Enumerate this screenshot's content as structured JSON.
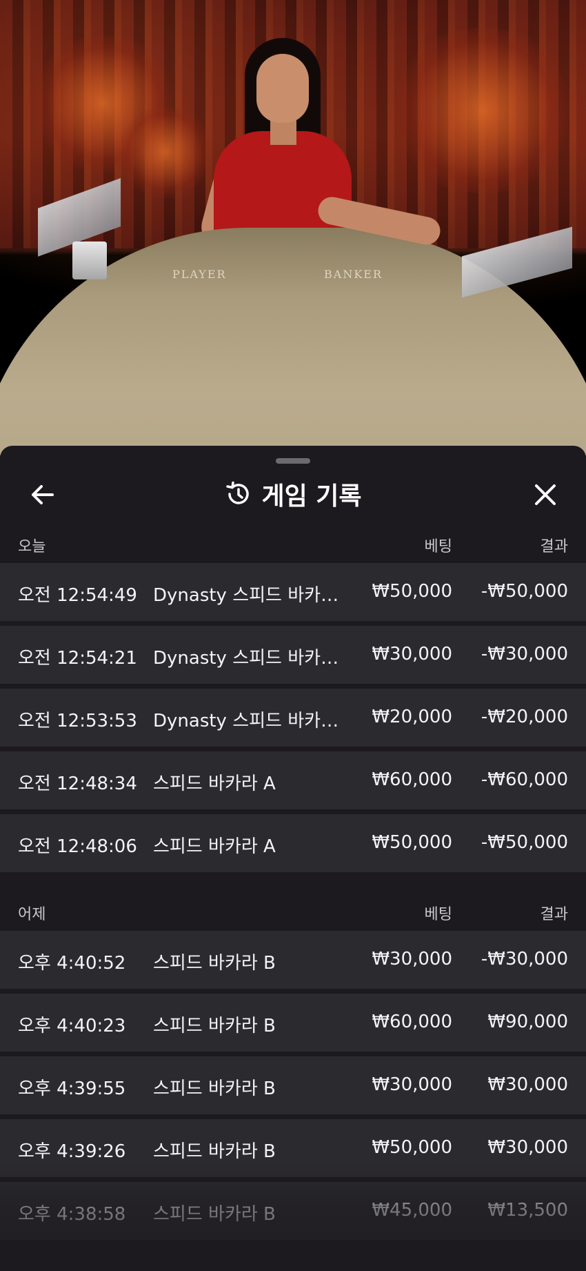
{
  "video": {
    "table_labels": {
      "player": "PLAYER",
      "banker": "BANKER"
    }
  },
  "header": {
    "title": "게임 기록",
    "back_icon": "arrow-left-icon",
    "history_icon": "history-icon",
    "close_icon": "close-icon"
  },
  "sections": [
    {
      "day": "오늘",
      "bet_header": "베팅",
      "result_header": "결과",
      "rows": [
        {
          "time": "오전 12:54:49",
          "game": "Dynasty 스피드 바카라 A",
          "bet": "₩50,000",
          "result": "-₩50,000"
        },
        {
          "time": "오전 12:54:21",
          "game": "Dynasty 스피드 바카라 A",
          "bet": "₩30,000",
          "result": "-₩30,000"
        },
        {
          "time": "오전 12:53:53",
          "game": "Dynasty 스피드 바카라 A",
          "bet": "₩20,000",
          "result": "-₩20,000"
        },
        {
          "time": "오전 12:48:34",
          "game": "스피드 바카라 A",
          "bet": "₩60,000",
          "result": "-₩60,000"
        },
        {
          "time": "오전 12:48:06",
          "game": "스피드 바카라 A",
          "bet": "₩50,000",
          "result": "-₩50,000"
        }
      ]
    },
    {
      "day": "어제",
      "bet_header": "베팅",
      "result_header": "결과",
      "rows": [
        {
          "time": "오후 4:40:52",
          "game": "스피드 바카라 B",
          "bet": "₩30,000",
          "result": "-₩30,000"
        },
        {
          "time": "오후 4:40:23",
          "game": "스피드 바카라 B",
          "bet": "₩60,000",
          "result": "₩90,000"
        },
        {
          "time": "오후 4:39:55",
          "game": "스피드 바카라 B",
          "bet": "₩30,000",
          "result": "₩30,000"
        },
        {
          "time": "오후 4:39:26",
          "game": "스피드 바카라 B",
          "bet": "₩50,000",
          "result": "₩30,000"
        },
        {
          "time": "오후 4:38:58",
          "game": "스피드 바카라 B",
          "bet": "₩45,000",
          "result": "₩13,500"
        }
      ]
    }
  ]
}
